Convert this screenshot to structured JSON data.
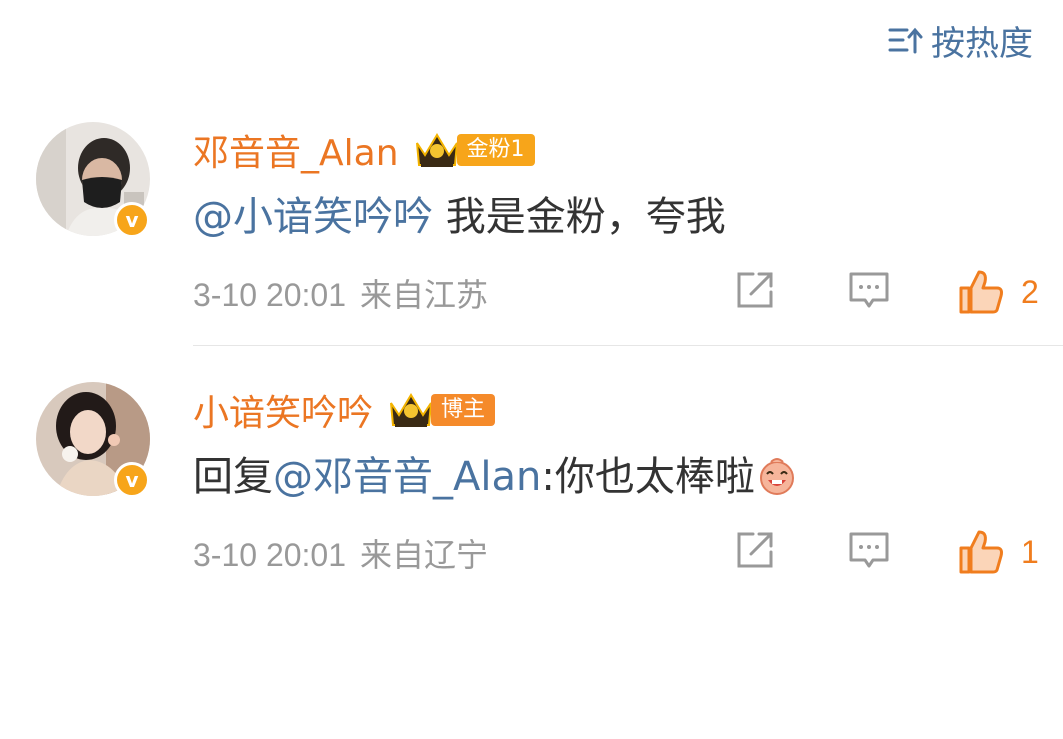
{
  "sort": {
    "label": "按热度"
  },
  "comments": [
    {
      "username": "邓音音_Alan",
      "badge": "金粉1",
      "mention": "@小谙笑吟吟",
      "text": " 我是金粉，夸我",
      "time": "3-10 20:01",
      "location": "来自江苏",
      "likes": "2"
    },
    {
      "username": "小谙笑吟吟",
      "badge": "博主",
      "reply_prefix": "回复",
      "mention": "@邓音音_Alan",
      "text": ":你也太棒啦",
      "time": "3-10 20:01",
      "location": "来自辽宁",
      "likes": "1"
    }
  ],
  "colors": {
    "username": "#eb7623",
    "mention": "#4a73a0",
    "like": "#f07d1e",
    "meta": "#999999"
  }
}
